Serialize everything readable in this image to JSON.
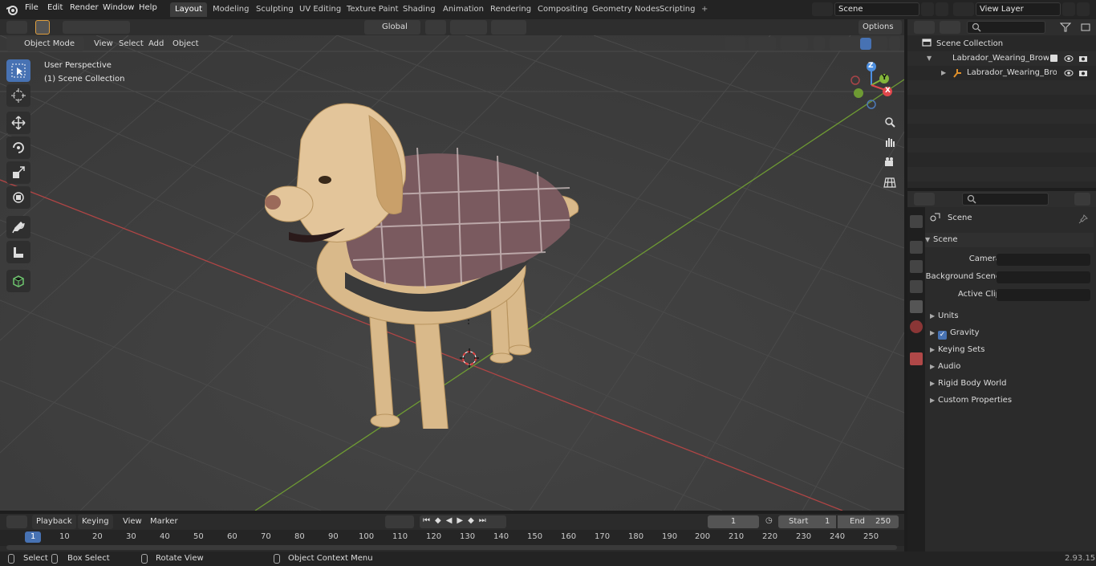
{
  "menus": [
    "File",
    "Edit",
    "Render",
    "Window",
    "Help"
  ],
  "workspaces": [
    "Layout",
    "Modeling",
    "Sculpting",
    "UV Editing",
    "Texture Paint",
    "Shading",
    "Animation",
    "Rendering",
    "Compositing",
    "Geometry Nodes",
    "Scripting"
  ],
  "add_tab": "+",
  "scene_name": "Scene",
  "view_layer": "View Layer",
  "header": {
    "mode": "Object Mode",
    "view": "View",
    "select": "Select",
    "add": "Add",
    "object": "Object",
    "transform_orientation": "Global",
    "options": "Options"
  },
  "viewport": {
    "perspective": "User Perspective",
    "collection": "(1) Scene Collection",
    "gizmo": {
      "z": "Z",
      "y": "Y",
      "x": "X"
    }
  },
  "outliner": {
    "root": "Scene Collection",
    "items": [
      "Labrador_Wearing_Brown_Cc",
      "Labrador_Wearing_Brow"
    ]
  },
  "properties": {
    "title": "Scene",
    "section": "Scene",
    "camera_label": "Camera",
    "background_label": "Background Scene",
    "clip_label": "Active Clip",
    "panels": [
      "Units",
      "Gravity",
      "Keying Sets",
      "Audio",
      "Rigid Body World",
      "Custom Properties"
    ]
  },
  "timeline": {
    "playback": "Playback",
    "keying": "Keying",
    "view": "View",
    "marker": "Marker",
    "current_frame": "1",
    "start_label": "Start",
    "start": "1",
    "end_label": "End",
    "end": "250",
    "ruler": [
      "1",
      "10",
      "20",
      "30",
      "40",
      "50",
      "60",
      "70",
      "80",
      "90",
      "100",
      "110",
      "120",
      "130",
      "140",
      "150",
      "160",
      "170",
      "180",
      "190",
      "200",
      "210",
      "220",
      "230",
      "240",
      "250"
    ]
  },
  "status": {
    "select": "Select",
    "box_select": "Box Select",
    "rotate_view": "Rotate View",
    "context_menu": "Object Context Menu",
    "version": "2.93.15"
  },
  "colors": {
    "accent": "#4772b3",
    "x_axis": "#e0474c",
    "y_axis": "#83b53a",
    "z_axis": "#4d8fe0"
  }
}
